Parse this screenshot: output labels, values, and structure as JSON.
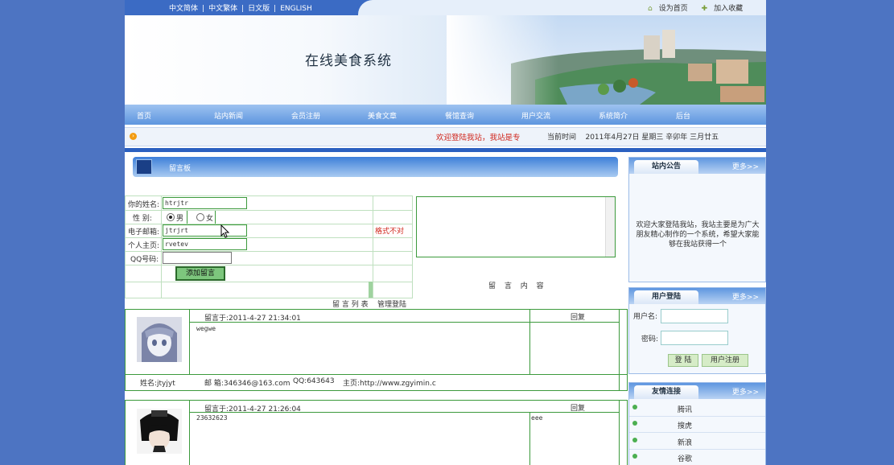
{
  "topbar": {
    "languages": [
      "中文简体",
      "中文繁体",
      "日文版",
      "ENGLISH"
    ],
    "set_homepage": "设为首页",
    "add_favorite": "加入收藏"
  },
  "banner": {
    "title": "在线美食系统"
  },
  "nav": [
    "首页",
    "站内新闻",
    "会员注册",
    "美食文章",
    "餐馆查询",
    "用户交流",
    "系统简介",
    "后台"
  ],
  "strip": {
    "welcome": "欢迎登陆我站，我站是专",
    "now_label": "当前时间",
    "date": "2011年4月27日 星期三 辛卯年 三月廿五"
  },
  "guestbook": {
    "title": "留言板",
    "form": {
      "name_label": "你的姓名:",
      "name_value": "htrjtr",
      "gender_label": "性 别:",
      "gender_male": "男",
      "gender_female": "女",
      "email_label": "电子邮箱:",
      "email_value": "jtrjrt",
      "email_error": "格式不对",
      "homepage_label": "个人主页:",
      "homepage_value": "rvetev",
      "qq_label": "QQ号码:",
      "qq_value": "",
      "submit": "添加留言",
      "content_label": "留 言 内 容"
    },
    "list_label": "留 言 列 表",
    "admin_login": "管理登陆",
    "messages": [
      {
        "time": "留言于:2011-4-27 21:34:01",
        "reply_label": "回复",
        "body": "wegwe",
        "reply_text": "",
        "name": "姓名:jtyjyt",
        "email": "邮 箱:346346@163.com",
        "qq": "QQ:643643",
        "homepage": "主页:http://www.zgyimin.c"
      },
      {
        "time": "留言于:2011-4-27 21:26:04",
        "reply_label": "回复",
        "body": "23632623",
        "reply_text": "eee"
      }
    ]
  },
  "sidebar": {
    "more": "更多>>",
    "notice": {
      "title": "站内公告",
      "text": "欢迎大家登陆我站，我站主要是为广大朋友精心制作的一个系统，希望大家能够在我站获得一个"
    },
    "login": {
      "title": "用户登陆",
      "username_label": "用户名:",
      "password_label": "密码:",
      "login_btn": "登 陆",
      "register_btn": "用户注册"
    },
    "links": {
      "title": "友情连接",
      "items": [
        "腾讯",
        "搜虎",
        "新浪",
        "谷歌"
      ]
    }
  },
  "colors": {
    "background": "#4d74c2",
    "accent": "#3b6bc4",
    "error": "#d0261c",
    "green": "#3c9a3c"
  }
}
